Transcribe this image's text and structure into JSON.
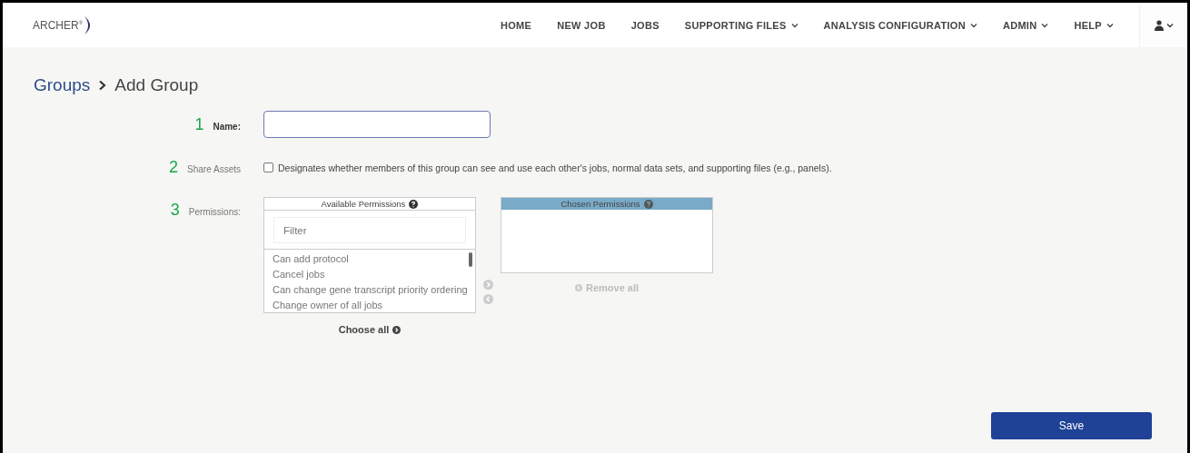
{
  "header": {
    "logo": "ARCHER$^{®}$",
    "nav": [
      {
        "label": "HOME",
        "dropdown": false
      },
      {
        "label": "NEW JOB",
        "dropdown": false
      },
      {
        "label": "JOBS",
        "dropdown": false
      },
      {
        "label": "SUPPORTING FILES",
        "dropdown": true
      },
      {
        "label": "ANALYSIS CONFIGURATION",
        "dropdown": true
      },
      {
        "label": "ADMIN",
        "dropdown": true
      },
      {
        "label": "HELP",
        "dropdown": true
      }
    ]
  },
  "breadcrumb": {
    "parent": "Groups",
    "current": "Add Group"
  },
  "form": {
    "name": {
      "marker": "1",
      "label": "Name:"
    },
    "share_assets": {
      "marker": "2",
      "label": "Share Assets",
      "checked": false,
      "description": "Designates whether members of this group can see and use each other's jobs, normal data sets, and supporting files (e.g., panels)."
    },
    "permissions": {
      "marker": "3",
      "label": "Permissions:",
      "available": {
        "title": "Available Permissions",
        "filter_placeholder": "Filter",
        "items": [
          "Can add protocol",
          "Cancel jobs",
          "Can change gene transcript priority ordering",
          "Change owner of all jobs"
        ],
        "action": "Choose all"
      },
      "chosen": {
        "title": "Chosen Permissions",
        "action": "Remove all"
      }
    }
  },
  "save_button": "Save"
}
